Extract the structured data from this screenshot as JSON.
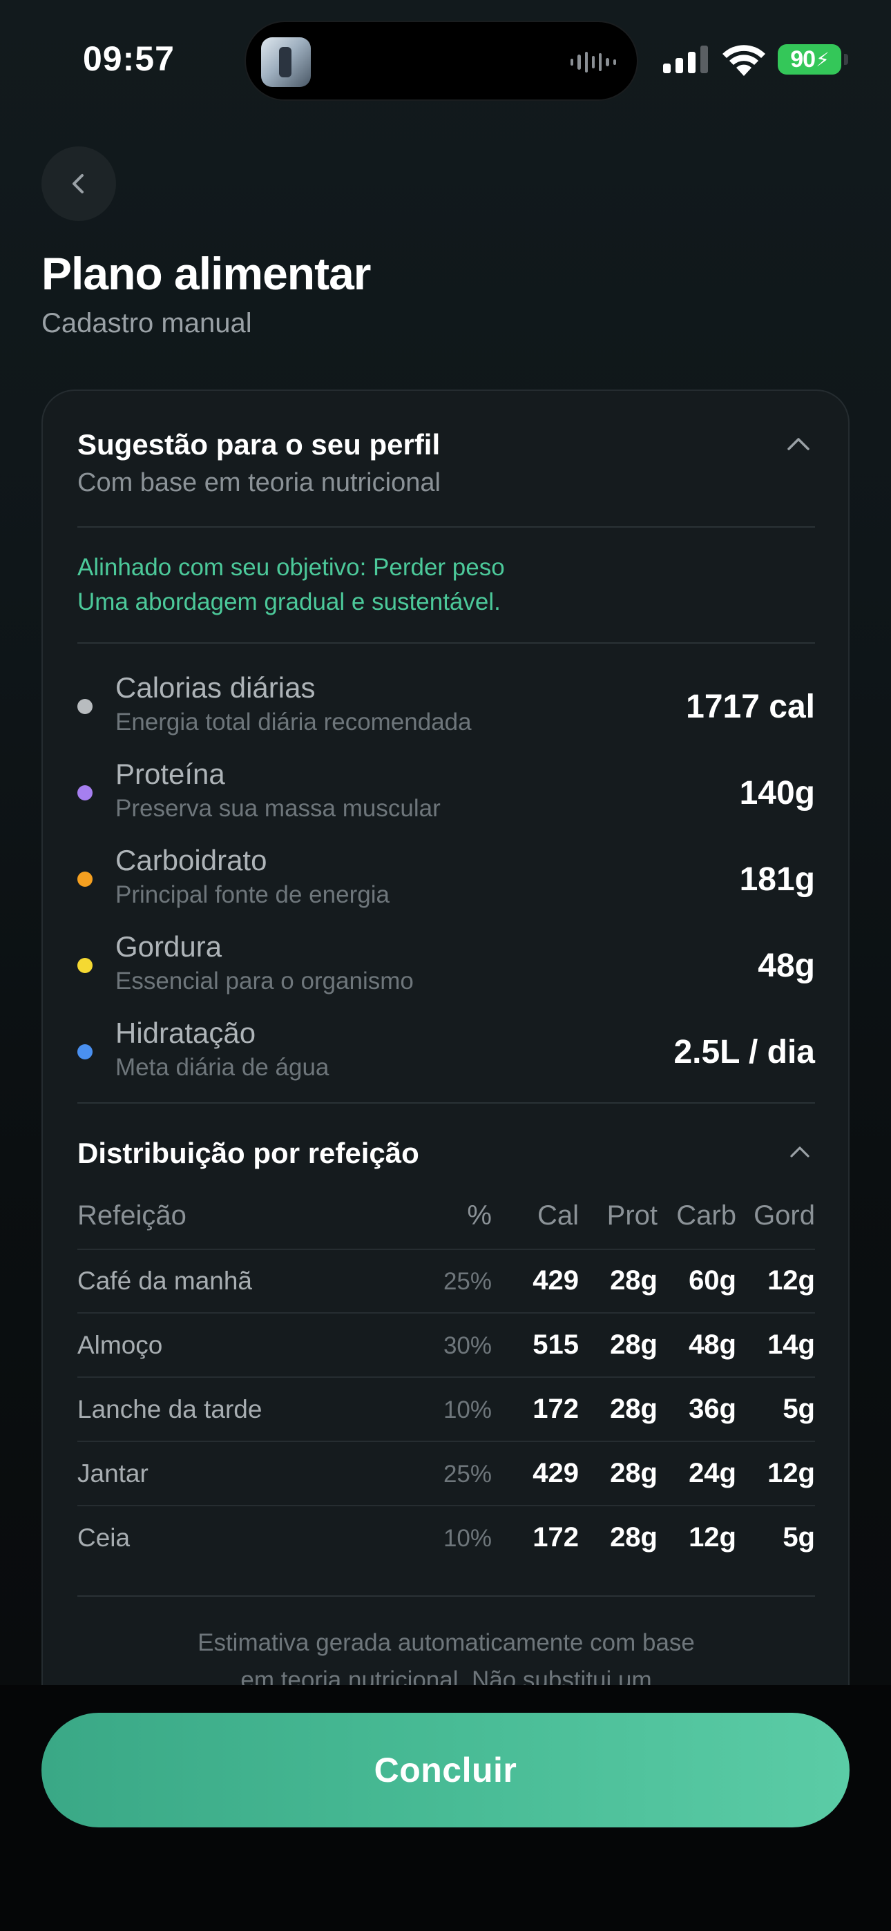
{
  "status_bar": {
    "time": "09:57",
    "battery": "90"
  },
  "header": {
    "title": "Plano alimentar",
    "subtitle": "Cadastro manual",
    "back_icon": "chevron-left-icon"
  },
  "suggestion": {
    "title": "Sugestão para o seu perfil",
    "subtitle": "Com base em teoria nutricional",
    "goal_line_1": "Alinhado com seu objetivo: Perder peso",
    "goal_line_2": "Uma abordagem gradual e sustentável.",
    "nutrients": [
      {
        "label": "Calorias diárias",
        "desc": "Energia total diária recomendada",
        "value": "1717 cal",
        "color": "#b8bcbf"
      },
      {
        "label": "Proteína",
        "desc": "Preserva sua massa muscular",
        "value": "140g",
        "color": "#a67ff0"
      },
      {
        "label": "Carboidrato",
        "desc": "Principal fonte de energia",
        "value": "181g",
        "color": "#f5a020"
      },
      {
        "label": "Gordura",
        "desc": "Essencial para o organismo",
        "value": "48g",
        "color": "#f5d932"
      },
      {
        "label": "Hidratação",
        "desc": "Meta diária de água",
        "value": "2.5L / dia",
        "color": "#4a90f0"
      }
    ]
  },
  "distribution": {
    "title": "Distribuição por refeição",
    "columns": {
      "meal": "Refeição",
      "pct": "%",
      "cal": "Cal",
      "prot": "Prot",
      "carb": "Carb",
      "gord": "Gord"
    },
    "rows": [
      {
        "meal": "Café da manhã",
        "pct": "25%",
        "cal": "429",
        "prot": "28g",
        "carb": "60g",
        "gord": "12g"
      },
      {
        "meal": "Almoço",
        "pct": "30%",
        "cal": "515",
        "prot": "28g",
        "carb": "48g",
        "gord": "14g"
      },
      {
        "meal": "Lanche da tarde",
        "pct": "10%",
        "cal": "172",
        "prot": "28g",
        "carb": "36g",
        "gord": "5g"
      },
      {
        "meal": "Jantar",
        "pct": "25%",
        "cal": "429",
        "prot": "28g",
        "carb": "24g",
        "gord": "12g"
      },
      {
        "meal": "Ceia",
        "pct": "10%",
        "cal": "172",
        "prot": "28g",
        "carb": "12g",
        "gord": "5g"
      }
    ],
    "footnote_line_1": "Estimativa gerada automaticamente com base",
    "footnote_line_2": "em teoria nutricional. Não substitui um"
  },
  "cta": {
    "label": "Concluir"
  },
  "colors": {
    "accent": "#4cc99a",
    "background": "#0b0e10",
    "card": "#151b1e"
  }
}
